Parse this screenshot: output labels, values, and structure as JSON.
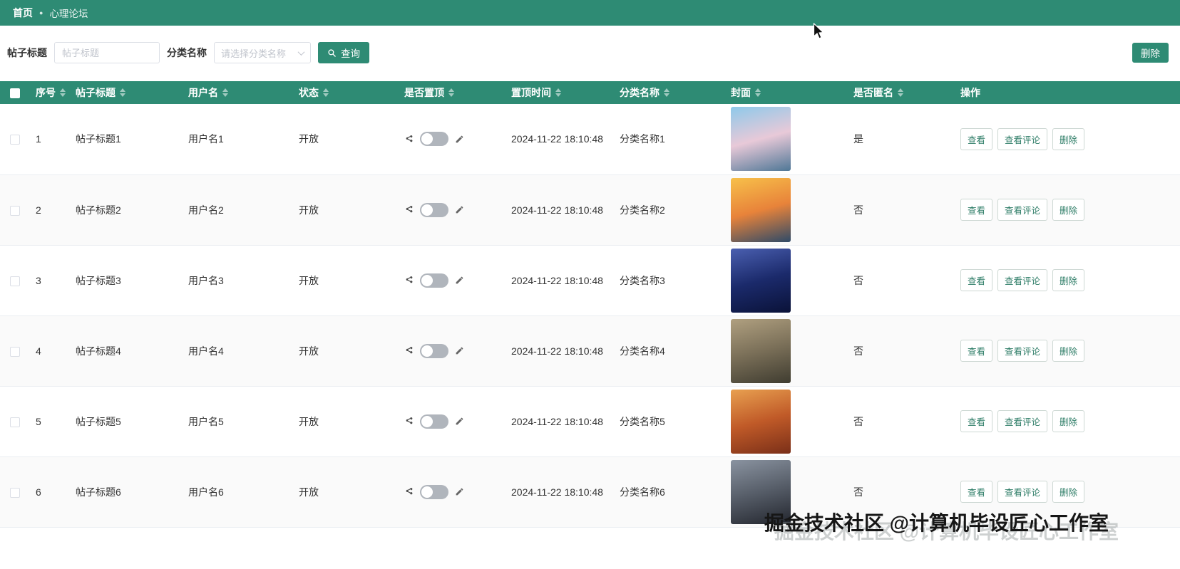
{
  "colors": {
    "primary": "#2e8b74",
    "row_alt": "#fafafa",
    "border": "#ebeef2",
    "action_text": "#2e7d67"
  },
  "topbar": {
    "breadcrumb": {
      "home": "首页",
      "current": "心理论坛"
    }
  },
  "filters": {
    "title_label": "帖子标题",
    "title_placeholder": "帖子标题",
    "category_label": "分类名称",
    "category_placeholder": "请选择分类名称",
    "search_button": "查询",
    "delete_button": "删除"
  },
  "icons": {
    "search": "search-icon",
    "chevron": "chevron-down-icon",
    "share": "share-icon",
    "edit": "edit-icon"
  },
  "table": {
    "columns": [
      "序号",
      "帖子标题",
      "用户名",
      "状态",
      "是否置顶",
      "置顶时间",
      "分类名称",
      "封面",
      "是否匿名",
      "操作"
    ],
    "actions": [
      "查看",
      "查看评论",
      "删除"
    ],
    "rows": [
      {
        "index": "1",
        "title": "帖子标题1",
        "user": "用户名1",
        "status": "开放",
        "pin_time": "2024-11-22 18:10:48",
        "category": "分类名称1",
        "anonymous": "是",
        "cover_colors": [
          "#8ec9ea",
          "#e8c9d8",
          "#4f7796"
        ]
      },
      {
        "index": "2",
        "title": "帖子标题2",
        "user": "用户名2",
        "status": "开放",
        "pin_time": "2024-11-22 18:10:48",
        "category": "分类名称2",
        "anonymous": "否",
        "cover_colors": [
          "#f7c04a",
          "#e8833a",
          "#2e4a68"
        ]
      },
      {
        "index": "3",
        "title": "帖子标题3",
        "user": "用户名3",
        "status": "开放",
        "pin_time": "2024-11-22 18:10:48",
        "category": "分类名称3",
        "anonymous": "否",
        "cover_colors": [
          "#4a5fb0",
          "#1b2a6b",
          "#0a1238"
        ]
      },
      {
        "index": "4",
        "title": "帖子标题4",
        "user": "用户名4",
        "status": "开放",
        "pin_time": "2024-11-22 18:10:48",
        "category": "分类名称4",
        "anonymous": "否",
        "cover_colors": [
          "#b0a080",
          "#7a6f58",
          "#3f3c30"
        ]
      },
      {
        "index": "5",
        "title": "帖子标题5",
        "user": "用户名5",
        "status": "开放",
        "pin_time": "2024-11-22 18:10:48",
        "category": "分类名称5",
        "anonymous": "否",
        "cover_colors": [
          "#e8a050",
          "#c05a28",
          "#7a2f18"
        ]
      },
      {
        "index": "6",
        "title": "帖子标题6",
        "user": "用户名6",
        "status": "开放",
        "pin_time": "2024-11-22 18:10:48",
        "category": "分类名称6",
        "anonymous": "否",
        "cover_colors": [
          "#8a93a0",
          "#565d68",
          "#23262e"
        ]
      }
    ]
  },
  "watermark": "掘金技术社区 @计算机毕设匠心工作室"
}
